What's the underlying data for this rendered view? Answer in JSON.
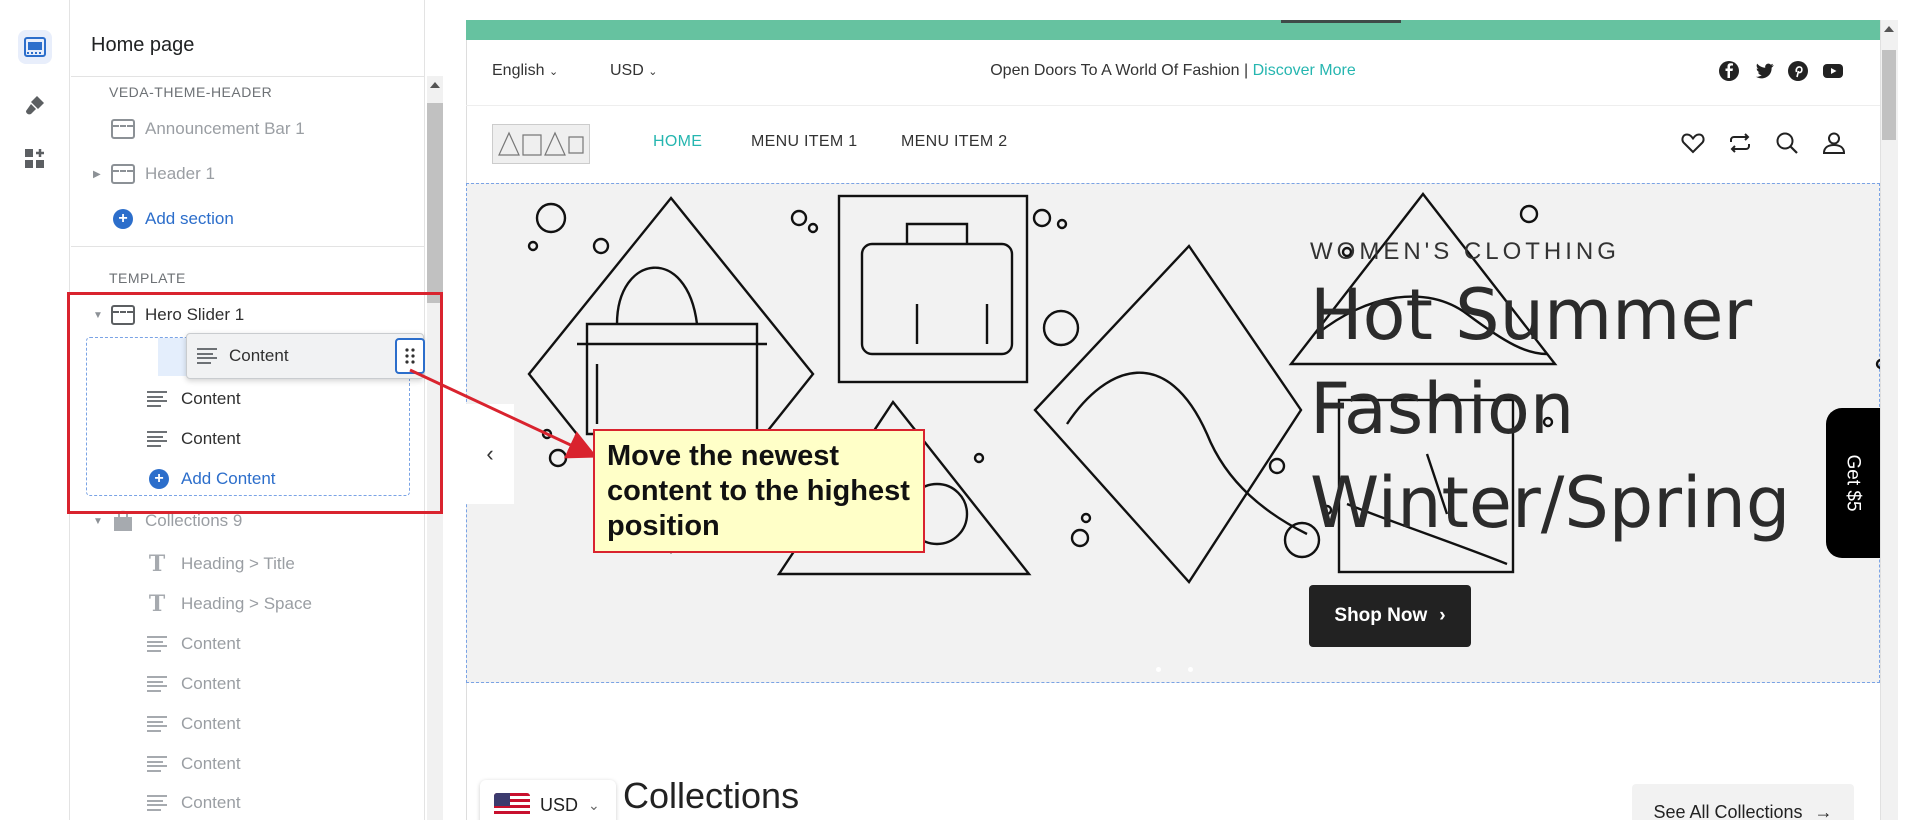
{
  "sidebar": {
    "title": "Home page",
    "header_group_label": "VEDA-THEME-HEADER",
    "header_items": [
      {
        "label": "Announcement Bar 1",
        "icon": "section-icon"
      },
      {
        "label": "Header 1",
        "icon": "section-icon"
      }
    ],
    "add_section_label": "Add section",
    "template_group_label": "TEMPLATE",
    "hero_slider_label": "Hero Slider 1",
    "dragging_item_label": "Content",
    "hero_children": [
      "Content",
      "Content"
    ],
    "add_content_label": "Add Content",
    "collections_label": "Collections 9",
    "collections_children": [
      {
        "label": "Heading > Title",
        "icon": "text-icon"
      },
      {
        "label": "Heading > Space",
        "icon": "text-icon"
      },
      {
        "label": "Content",
        "icon": "lines-icon"
      },
      {
        "label": "Content",
        "icon": "lines-icon"
      },
      {
        "label": "Content",
        "icon": "lines-icon"
      },
      {
        "label": "Content",
        "icon": "lines-icon"
      },
      {
        "label": "Content",
        "icon": "lines-icon"
      }
    ]
  },
  "annotation": {
    "callout_text": "Move the newest content to the highest position",
    "color": "#d9232e"
  },
  "preview": {
    "language": "English",
    "currency": "USD",
    "announcement_text": "Open Doors To A World Of Fashion |",
    "announcement_link": "Discover More",
    "nav": [
      "HOME",
      "MENU ITEM 1",
      "MENU ITEM 2"
    ],
    "hero": {
      "eyebrow": "WOMEN'S CLOTHING",
      "title": "Hot Summer Fashion Winter/Spring",
      "button": "Shop Now"
    },
    "side_tab": "Get $5",
    "collections_title": "Collections",
    "see_all_label": "See All Collections",
    "currency_selector": "USD",
    "accent_color": "#26b6b0",
    "bar_color": "#66c2a0"
  }
}
